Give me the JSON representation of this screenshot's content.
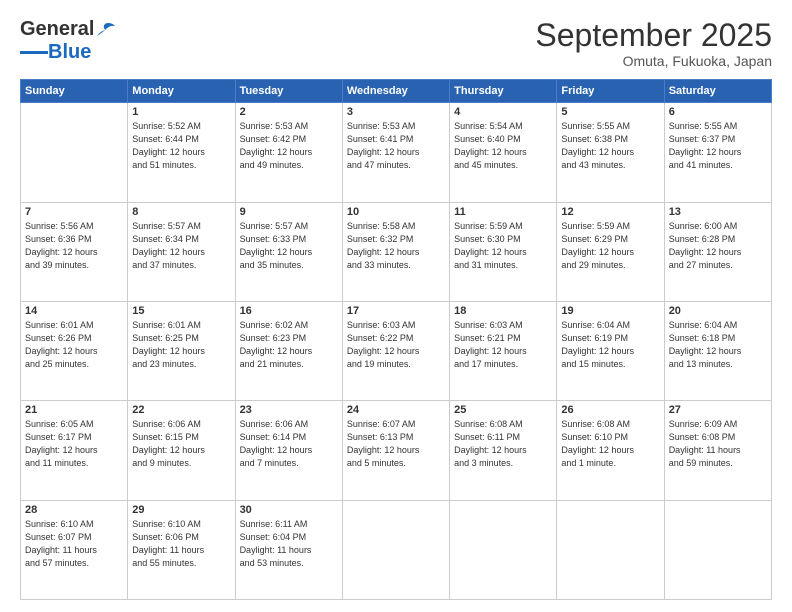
{
  "logo": {
    "general": "General",
    "blue": "Blue"
  },
  "header": {
    "month": "September 2025",
    "location": "Omuta, Fukuoka, Japan"
  },
  "days_of_week": [
    "Sunday",
    "Monday",
    "Tuesday",
    "Wednesday",
    "Thursday",
    "Friday",
    "Saturday"
  ],
  "weeks": [
    [
      {
        "day": "",
        "info": ""
      },
      {
        "day": "1",
        "info": "Sunrise: 5:52 AM\nSunset: 6:44 PM\nDaylight: 12 hours\nand 51 minutes."
      },
      {
        "day": "2",
        "info": "Sunrise: 5:53 AM\nSunset: 6:42 PM\nDaylight: 12 hours\nand 49 minutes."
      },
      {
        "day": "3",
        "info": "Sunrise: 5:53 AM\nSunset: 6:41 PM\nDaylight: 12 hours\nand 47 minutes."
      },
      {
        "day": "4",
        "info": "Sunrise: 5:54 AM\nSunset: 6:40 PM\nDaylight: 12 hours\nand 45 minutes."
      },
      {
        "day": "5",
        "info": "Sunrise: 5:55 AM\nSunset: 6:38 PM\nDaylight: 12 hours\nand 43 minutes."
      },
      {
        "day": "6",
        "info": "Sunrise: 5:55 AM\nSunset: 6:37 PM\nDaylight: 12 hours\nand 41 minutes."
      }
    ],
    [
      {
        "day": "7",
        "info": "Sunrise: 5:56 AM\nSunset: 6:36 PM\nDaylight: 12 hours\nand 39 minutes."
      },
      {
        "day": "8",
        "info": "Sunrise: 5:57 AM\nSunset: 6:34 PM\nDaylight: 12 hours\nand 37 minutes."
      },
      {
        "day": "9",
        "info": "Sunrise: 5:57 AM\nSunset: 6:33 PM\nDaylight: 12 hours\nand 35 minutes."
      },
      {
        "day": "10",
        "info": "Sunrise: 5:58 AM\nSunset: 6:32 PM\nDaylight: 12 hours\nand 33 minutes."
      },
      {
        "day": "11",
        "info": "Sunrise: 5:59 AM\nSunset: 6:30 PM\nDaylight: 12 hours\nand 31 minutes."
      },
      {
        "day": "12",
        "info": "Sunrise: 5:59 AM\nSunset: 6:29 PM\nDaylight: 12 hours\nand 29 minutes."
      },
      {
        "day": "13",
        "info": "Sunrise: 6:00 AM\nSunset: 6:28 PM\nDaylight: 12 hours\nand 27 minutes."
      }
    ],
    [
      {
        "day": "14",
        "info": "Sunrise: 6:01 AM\nSunset: 6:26 PM\nDaylight: 12 hours\nand 25 minutes."
      },
      {
        "day": "15",
        "info": "Sunrise: 6:01 AM\nSunset: 6:25 PM\nDaylight: 12 hours\nand 23 minutes."
      },
      {
        "day": "16",
        "info": "Sunrise: 6:02 AM\nSunset: 6:23 PM\nDaylight: 12 hours\nand 21 minutes."
      },
      {
        "day": "17",
        "info": "Sunrise: 6:03 AM\nSunset: 6:22 PM\nDaylight: 12 hours\nand 19 minutes."
      },
      {
        "day": "18",
        "info": "Sunrise: 6:03 AM\nSunset: 6:21 PM\nDaylight: 12 hours\nand 17 minutes."
      },
      {
        "day": "19",
        "info": "Sunrise: 6:04 AM\nSunset: 6:19 PM\nDaylight: 12 hours\nand 15 minutes."
      },
      {
        "day": "20",
        "info": "Sunrise: 6:04 AM\nSunset: 6:18 PM\nDaylight: 12 hours\nand 13 minutes."
      }
    ],
    [
      {
        "day": "21",
        "info": "Sunrise: 6:05 AM\nSunset: 6:17 PM\nDaylight: 12 hours\nand 11 minutes."
      },
      {
        "day": "22",
        "info": "Sunrise: 6:06 AM\nSunset: 6:15 PM\nDaylight: 12 hours\nand 9 minutes."
      },
      {
        "day": "23",
        "info": "Sunrise: 6:06 AM\nSunset: 6:14 PM\nDaylight: 12 hours\nand 7 minutes."
      },
      {
        "day": "24",
        "info": "Sunrise: 6:07 AM\nSunset: 6:13 PM\nDaylight: 12 hours\nand 5 minutes."
      },
      {
        "day": "25",
        "info": "Sunrise: 6:08 AM\nSunset: 6:11 PM\nDaylight: 12 hours\nand 3 minutes."
      },
      {
        "day": "26",
        "info": "Sunrise: 6:08 AM\nSunset: 6:10 PM\nDaylight: 12 hours\nand 1 minute."
      },
      {
        "day": "27",
        "info": "Sunrise: 6:09 AM\nSunset: 6:08 PM\nDaylight: 11 hours\nand 59 minutes."
      }
    ],
    [
      {
        "day": "28",
        "info": "Sunrise: 6:10 AM\nSunset: 6:07 PM\nDaylight: 11 hours\nand 57 minutes."
      },
      {
        "day": "29",
        "info": "Sunrise: 6:10 AM\nSunset: 6:06 PM\nDaylight: 11 hours\nand 55 minutes."
      },
      {
        "day": "30",
        "info": "Sunrise: 6:11 AM\nSunset: 6:04 PM\nDaylight: 11 hours\nand 53 minutes."
      },
      {
        "day": "",
        "info": ""
      },
      {
        "day": "",
        "info": ""
      },
      {
        "day": "",
        "info": ""
      },
      {
        "day": "",
        "info": ""
      }
    ]
  ]
}
